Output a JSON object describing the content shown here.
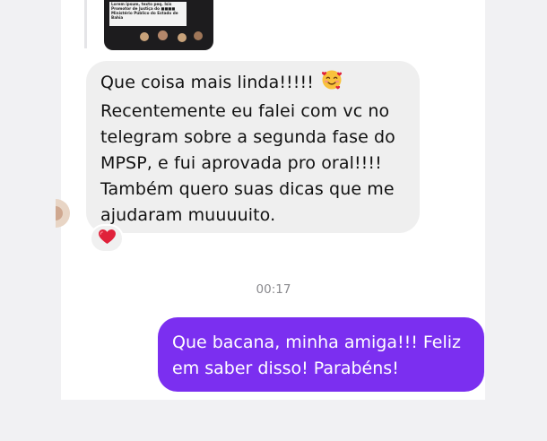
{
  "shared_post": {
    "caption_lines": [
      "Lorem ipsum, texto peq. Isis",
      "Promotor de Justiça do ■■■■",
      "Ministério Público do Estado de",
      "Bahia"
    ]
  },
  "incoming_message": {
    "lines": [
      "Que coisa mais linda!!!!!",
      "Recentemente eu falei com vc no",
      "telegram sobre a segunda fase do",
      "MPSP, e fui aprovada pro oral!!!!",
      "Também quero suas dicas que me",
      "ajudaram muuuuito."
    ],
    "emoji": "smiling-face-with-hearts-icon",
    "reaction": "red-heart-icon"
  },
  "timestamp": "00:17",
  "outgoing_message": {
    "lines": [
      "Que bacana, minha amiga!!! Feliz",
      "em saber disso! Parabéns!"
    ]
  },
  "colors": {
    "outgoing_bubble": "#7b2ff0",
    "incoming_bubble": "#efefef",
    "reaction_heart": "#e0213a"
  }
}
